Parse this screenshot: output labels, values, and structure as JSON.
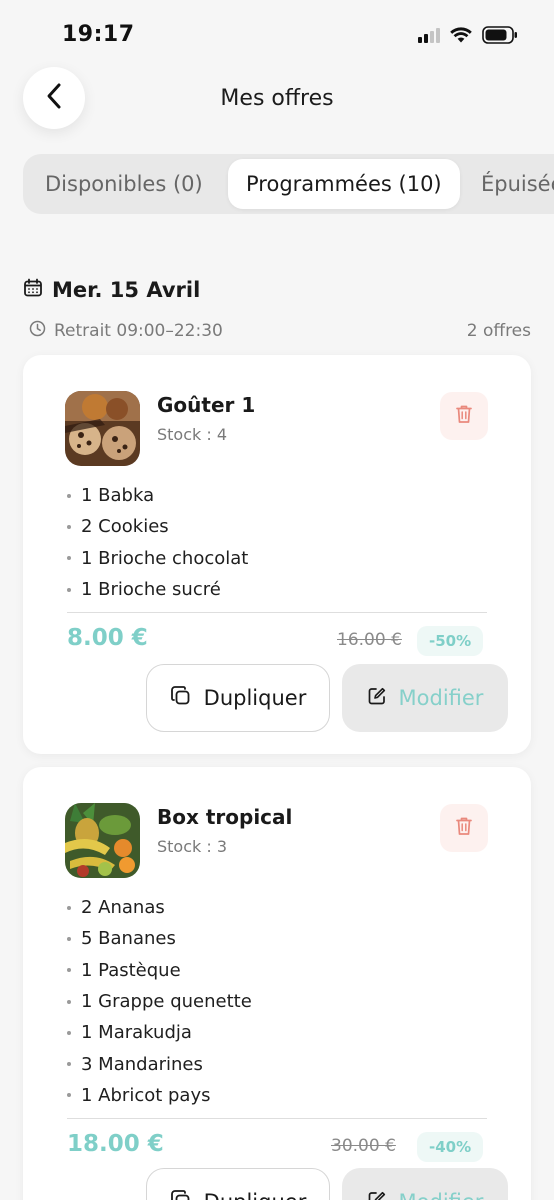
{
  "status_bar": {
    "time": "19:17"
  },
  "header": {
    "title": "Mes offres",
    "back_icon": "chevron-left-icon"
  },
  "tabs": [
    {
      "label": "Disponibles (0)",
      "active": false
    },
    {
      "label": "Programmées (10)",
      "active": true
    },
    {
      "label": "Épuisées",
      "active": false
    }
  ],
  "date_group": {
    "date": "Mer. 15 Avril",
    "pickup": "Retrait 09:00–22:30",
    "count": "2 offres"
  },
  "offers": [
    {
      "title": "Goûter 1",
      "stock": "Stock : 4",
      "items": [
        "1 Babka",
        "2 Cookies",
        "1 Brioche chocolat",
        "1 Brioche sucré"
      ],
      "price": "8.00 €",
      "old_price": "16.00 €",
      "discount": "-50%",
      "duplicate_label": "Dupliquer",
      "edit_label": "Modifier"
    },
    {
      "title": "Box tropical",
      "stock": "Stock : 3",
      "items": [
        "2 Ananas",
        "5 Bananes",
        "1 Pastèque",
        "1 Grappe quenette",
        "1 Marakudja",
        "3 Mandarines",
        "1 Abricot pays"
      ],
      "price": "18.00 €",
      "old_price": "30.00 €",
      "discount": "-40%",
      "duplicate_label": "Dupliquer",
      "edit_label": "Modifier"
    }
  ],
  "colors": {
    "accent": "#7fcfc8",
    "danger": "#e9897d",
    "background": "#f6f6f6"
  }
}
